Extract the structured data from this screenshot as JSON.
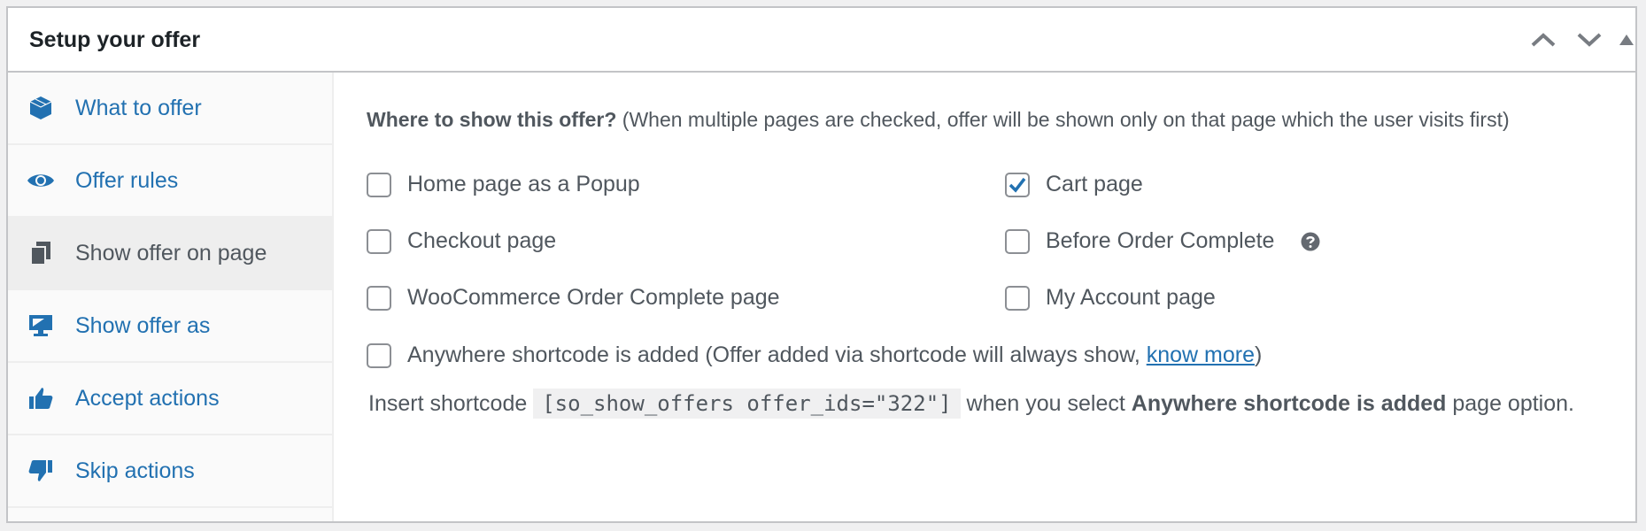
{
  "header": {
    "title": "Setup your offer",
    "actions": [
      {
        "name": "move-up",
        "icon": "chevron-up-icon"
      },
      {
        "name": "move-down",
        "icon": "chevron-down-icon"
      },
      {
        "name": "toggle-panel",
        "icon": "triangle-up-icon"
      }
    ]
  },
  "sidebar": {
    "items": [
      {
        "label": "What to offer",
        "icon": "cube-icon",
        "active": false
      },
      {
        "label": "Offer rules",
        "icon": "eye-icon",
        "active": false
      },
      {
        "label": "Show offer on page",
        "icon": "pages-icon",
        "active": true
      },
      {
        "label": "Show offer as",
        "icon": "monitor-icon",
        "active": false
      },
      {
        "label": "Accept actions",
        "icon": "thumbs-up-icon",
        "active": false
      },
      {
        "label": "Skip actions",
        "icon": "thumbs-down-icon",
        "active": false
      }
    ]
  },
  "main": {
    "heading_bold": "Where to show this offer?",
    "heading_note": "(When multiple pages are checked, offer will be shown only on that page which the user visits first)",
    "options": [
      {
        "label": "Home page as a Popup",
        "checked": false
      },
      {
        "label": "Cart page",
        "checked": true
      },
      {
        "label": "Checkout page",
        "checked": false
      },
      {
        "label": "Before Order Complete",
        "checked": false,
        "help": true
      },
      {
        "label": "WooCommerce Order Complete page",
        "checked": false
      },
      {
        "label": "My Account page",
        "checked": false
      }
    ],
    "anywhere": {
      "label": "Anywhere shortcode is added (Offer added via shortcode will always show, ",
      "link": "know more",
      "suffix": ")",
      "checked": false
    },
    "shortcode": {
      "prefix": "Insert shortcode ",
      "code": "[so_show_offers offer_ids=\"322\"]",
      "middle": " when you select ",
      "bold": "Anywhere shortcode is added",
      "suffix": " page option."
    }
  },
  "colors": {
    "accent": "#2271b1",
    "text": "#50575e",
    "title": "#1d2327",
    "border": "#c3c4c7",
    "active_tab_bg": "#eeeeee"
  }
}
